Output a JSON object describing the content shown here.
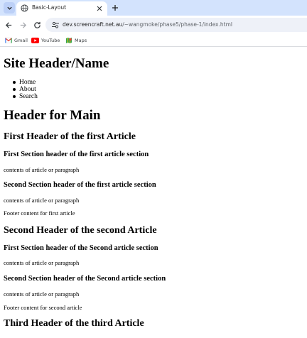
{
  "browser": {
    "tab_title": "Basic-Layout",
    "url_host": "dev.screencraft.net.au",
    "url_path": "/~wangmoke/phase5/phase-1/index.html",
    "bookmarks": [
      {
        "label": "Gmail",
        "icon": "gmail-icon"
      },
      {
        "label": "YouTube",
        "icon": "youtube-icon"
      },
      {
        "label": "Maps",
        "icon": "maps-icon"
      }
    ]
  },
  "page": {
    "site_header": "Site Header/Name",
    "nav": [
      "Home",
      "About",
      "Search"
    ],
    "main_header": "Header for Main",
    "articles": [
      {
        "header": "First Header of the first Article",
        "sections": [
          {
            "header": "First Section header of the first article section",
            "text": "contents of article or paragraph"
          },
          {
            "header": "Second Section header of the first article section",
            "text": "contents of article or paragraph"
          }
        ],
        "footer": "Footer content for first article"
      },
      {
        "header": "Second Header of the second Article",
        "sections": [
          {
            "header": "First Section header of the Second article section",
            "text": "contents of article or paragraph"
          },
          {
            "header": "Second Section header of the Second article section",
            "text": "contents of article or paragraph"
          }
        ],
        "footer": "Footer content for second article"
      },
      {
        "header": "Third Header of the third Article"
      }
    ]
  },
  "colors": {
    "tabstrip": "#d3e3fd",
    "omnibox": "#eef1f8",
    "text": "#000000"
  }
}
